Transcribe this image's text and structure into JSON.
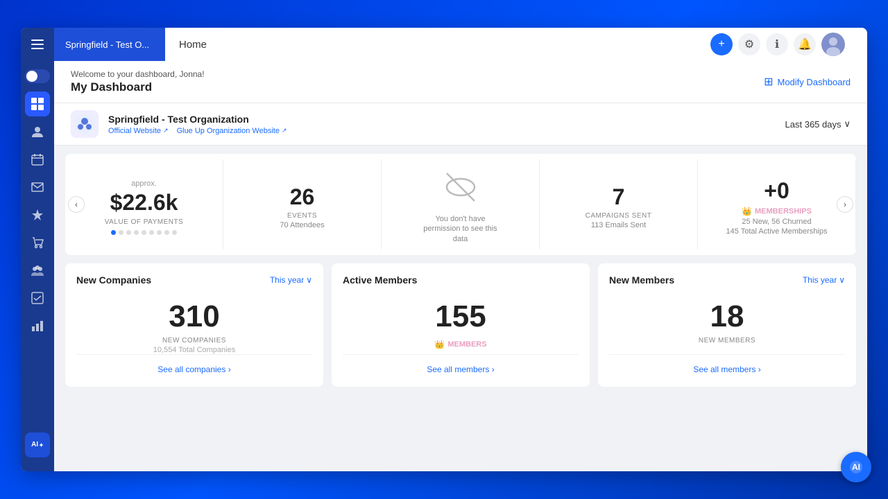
{
  "topbar": {
    "org_name": "Springfield - Test O...",
    "page_title": "Home",
    "add_icon": "+",
    "settings_icon": "⚙",
    "info_icon": "ℹ",
    "bell_icon": "🔔"
  },
  "sidebar": {
    "items": [
      {
        "id": "toggle",
        "icon": "≡",
        "label": "menu"
      },
      {
        "id": "grid",
        "icon": "⊞",
        "label": "dashboard",
        "active": true
      },
      {
        "id": "people",
        "icon": "👤",
        "label": "members"
      },
      {
        "id": "calendar",
        "icon": "📅",
        "label": "events"
      },
      {
        "id": "send",
        "icon": "✉",
        "label": "campaigns"
      },
      {
        "id": "trophy",
        "icon": "🏆",
        "label": "memberships"
      },
      {
        "id": "store",
        "icon": "🛍",
        "label": "commerce"
      },
      {
        "id": "community",
        "icon": "👥",
        "label": "community"
      },
      {
        "id": "check",
        "icon": "✓",
        "label": "tasks"
      },
      {
        "id": "chart",
        "icon": "📊",
        "label": "reports"
      }
    ],
    "ai_label": "AI"
  },
  "dashboard": {
    "welcome": "Welcome to your dashboard, Jonna!",
    "title": "My Dashboard",
    "modify_btn": "Modify Dashboard"
  },
  "org": {
    "name": "Springfield - Test Organization",
    "official_website_label": "Official Website",
    "official_website_icon": "↗",
    "glueup_website_label": "Glue Up Organization Website",
    "glueup_website_icon": "↗",
    "date_filter": "Last 365 days",
    "date_filter_icon": "∨"
  },
  "stats": {
    "nav_left": "‹",
    "nav_right": "›",
    "items": [
      {
        "label_top": "approx.",
        "value": "$22.6k",
        "sublabel": "VALUE OF PAYMENTS",
        "sub": null
      },
      {
        "label_top": null,
        "value": "26",
        "sublabel": "EVENTS",
        "sub": "70 Attendees"
      },
      {
        "label_top": null,
        "value": null,
        "sublabel": null,
        "sub": "You don't have permission to see this data",
        "icon": "🚫"
      },
      {
        "label_top": null,
        "value": "7",
        "sublabel": "CAMPAIGNS SENT",
        "sub": "113 Emails Sent"
      },
      {
        "label_top": null,
        "value": "+0",
        "sublabel": null,
        "sub": null,
        "memberships": "MEMBERSHIPS",
        "memberships_sub": "25 New, 56 Churned",
        "memberships_sub2": "145 Total Active Memberships"
      }
    ],
    "dots": 9,
    "active_dot": 1
  },
  "widgets": [
    {
      "id": "new-companies",
      "title": "New Companies",
      "filter": "This year",
      "filter_icon": "∨",
      "value": "310",
      "sublabel": "NEW COMPANIES",
      "sub2": "10,554 Total Companies",
      "see_all": "See all companies",
      "see_all_icon": "›"
    },
    {
      "id": "active-members",
      "title": "Active Members",
      "filter": null,
      "value": "155",
      "sublabel": null,
      "sub2": null,
      "members_badge": "MEMBERS",
      "see_all": "See all members",
      "see_all_icon": "›"
    },
    {
      "id": "new-members",
      "title": "New Members",
      "filter": "This year",
      "filter_icon": "∨",
      "value": "18",
      "sublabel": "NEW MEMBERS",
      "sub2": null,
      "see_all": "See all members",
      "see_all_icon": "›"
    }
  ],
  "ai_fab": "🤖"
}
